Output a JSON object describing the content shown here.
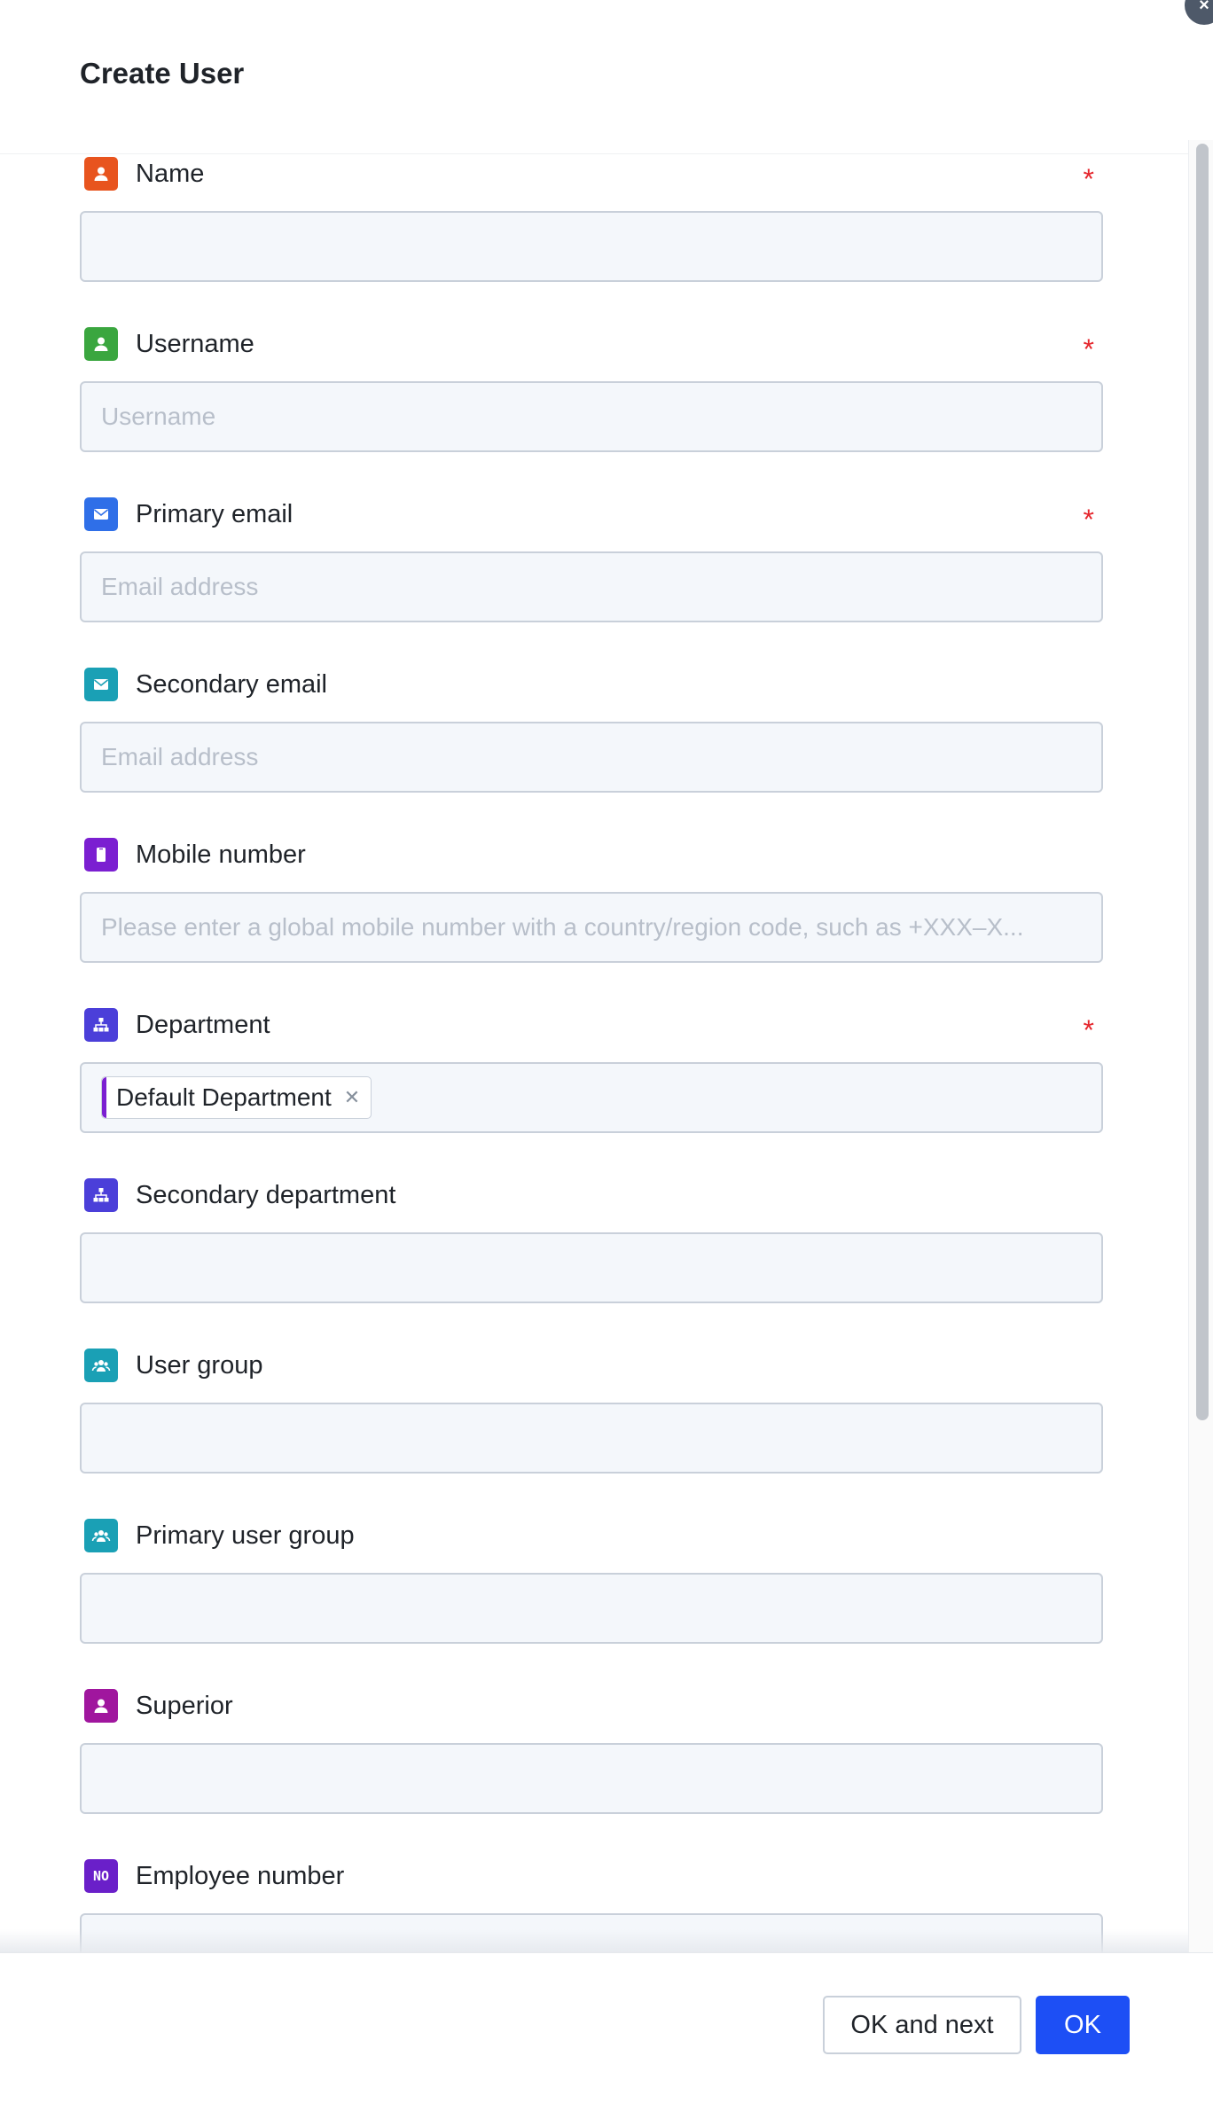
{
  "dialog": {
    "title": "Create User",
    "close_icon": "close-icon"
  },
  "fields": [
    {
      "key": "name",
      "label": "Name",
      "icon": "user-icon",
      "icon_color": "#e8541e",
      "required": true,
      "placeholder": "",
      "value": ""
    },
    {
      "key": "username",
      "label": "Username",
      "icon": "user-icon",
      "icon_color": "#3aa63f",
      "required": true,
      "placeholder": "Username",
      "value": ""
    },
    {
      "key": "primary_email",
      "label": "Primary email",
      "icon": "mail-icon",
      "icon_color": "#2f6fe8",
      "required": true,
      "placeholder": "Email address",
      "value": ""
    },
    {
      "key": "secondary_email",
      "label": "Secondary email",
      "icon": "mail-icon",
      "icon_color": "#1aa0b5",
      "required": false,
      "placeholder": "Email address",
      "value": ""
    },
    {
      "key": "mobile_number",
      "label": "Mobile number",
      "icon": "mobile-icon",
      "icon_color": "#7b1fd1",
      "required": false,
      "placeholder": "Please enter a global mobile number with a country/region code, such as +XXX–X...",
      "value": ""
    },
    {
      "key": "department",
      "label": "Department",
      "icon": "org-chart-icon",
      "icon_color": "#4b3fd9",
      "required": true,
      "tags": [
        "Default Department"
      ]
    },
    {
      "key": "secondary_department",
      "label": "Secondary department",
      "icon": "org-chart-icon",
      "icon_color": "#4b3fd9",
      "required": false,
      "placeholder": "",
      "value": ""
    },
    {
      "key": "user_group",
      "label": "User group",
      "icon": "group-icon",
      "icon_color": "#1aa0b5",
      "required": false,
      "placeholder": "",
      "value": ""
    },
    {
      "key": "primary_user_group",
      "label": "Primary user group",
      "icon": "group-icon",
      "icon_color": "#1aa0b5",
      "required": false,
      "placeholder": "",
      "value": ""
    },
    {
      "key": "superior",
      "label": "Superior",
      "icon": "user-icon",
      "icon_color": "#a0169e",
      "required": false,
      "placeholder": "",
      "value": ""
    },
    {
      "key": "employee_number",
      "label": "Employee number",
      "icon": "number-icon",
      "icon_color": "#6a1fc9",
      "icon_text": "NO",
      "required": false,
      "placeholder": "",
      "value": ""
    }
  ],
  "required_mark": "*",
  "footer": {
    "ok_and_next_label": "OK and next",
    "ok_label": "OK"
  }
}
